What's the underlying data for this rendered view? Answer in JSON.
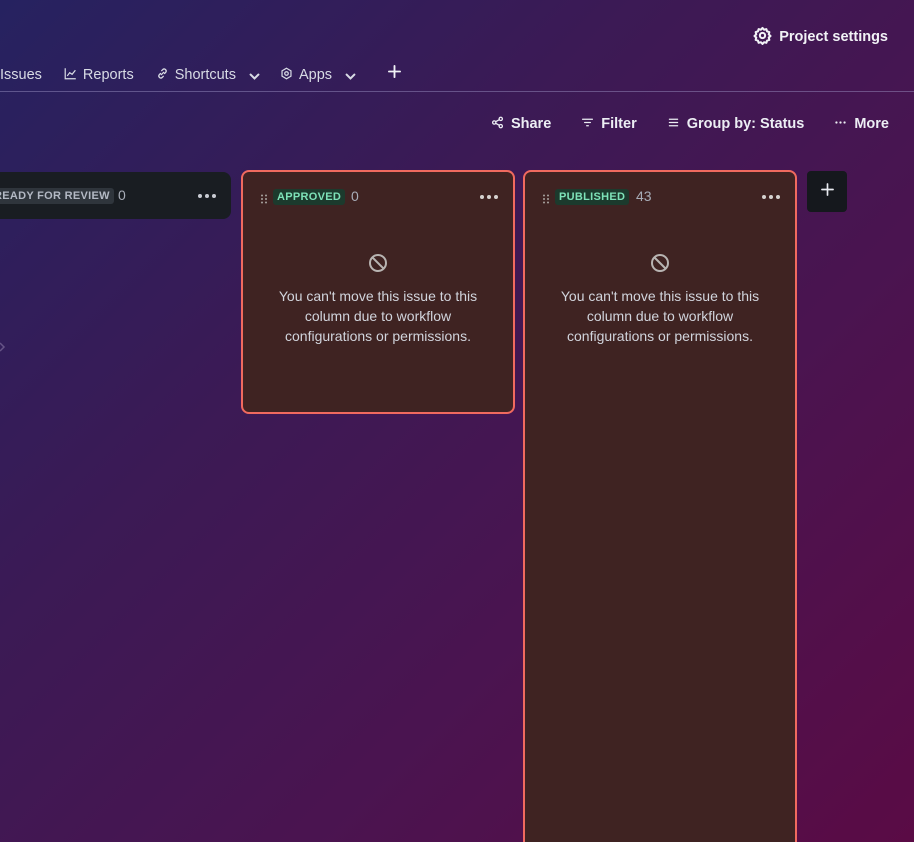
{
  "header": {
    "project_settings_label": "Project settings"
  },
  "nav": {
    "items": [
      {
        "label": "Issues",
        "icon": "issues-icon"
      },
      {
        "label": "Reports",
        "icon": "reports-icon"
      },
      {
        "label": "Shortcuts",
        "icon": "link-icon",
        "dropdown": true
      },
      {
        "label": "Apps",
        "icon": "apps-icon",
        "dropdown": true
      }
    ],
    "add_icon": "plus-icon"
  },
  "toolbar": {
    "share_label": "Share",
    "filter_label": "Filter",
    "group_by_label": "Group by: Status",
    "more_label": "More"
  },
  "columns": [
    {
      "status": "READY FOR REVIEW",
      "count": "0"
    },
    {
      "status": "APPROVED",
      "count": "0",
      "blocked_message": "You can't move this issue to this column due to workflow configurations or permissions."
    },
    {
      "status": "PUBLISHED",
      "count": "43",
      "blocked_message": "You can't move this issue to this column due to workflow configurations or permissions."
    }
  ],
  "colors": {
    "blocked_border": "#f06a5f",
    "blocked_bg": "#3f2322",
    "done_lozenge_text": "#7ee2b8",
    "done_lozenge_bg": "#1c3a2d"
  }
}
